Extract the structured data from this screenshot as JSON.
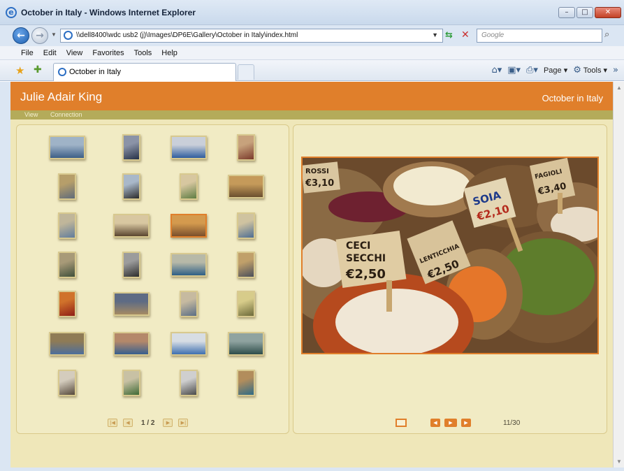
{
  "window": {
    "title": "October in Italy - Windows Internet Explorer"
  },
  "address_bar": {
    "url": "\\\\dell8400\\wdc usb2 (j)\\Images\\DP6E\\Gallery\\October in Italy\\index.html",
    "search_placeholder": "Google"
  },
  "menu": [
    "File",
    "Edit",
    "View",
    "Favorites",
    "Tools",
    "Help"
  ],
  "tab": {
    "label": "October in Italy"
  },
  "command_bar": {
    "page_label": "Page",
    "tools_label": "Tools"
  },
  "site": {
    "author": "Julie Adair King",
    "gallery_title": "October in Italy",
    "nav": [
      "View",
      "Connection"
    ]
  },
  "thumbnails": {
    "page_indicator": "1 / 2",
    "selected_index": 10,
    "items": [
      {
        "name": "harbor boats",
        "colors": [
          "#3d5f87",
          "#9fb3c7"
        ]
      },
      {
        "name": "cathedral night",
        "colors": [
          "#253147",
          "#8b93a7"
        ]
      },
      {
        "name": "statues skyline",
        "colors": [
          "#2f5d9e",
          "#c9cfd9"
        ]
      },
      {
        "name": "flag doorway",
        "colors": [
          "#7b3a2b",
          "#c7a27c"
        ]
      },
      {
        "name": "bridge river",
        "colors": [
          "#5f6b7a",
          "#b69e6a"
        ]
      },
      {
        "name": "tower silhouette",
        "colors": [
          "#2a2a2a",
          "#a9b8c9"
        ]
      },
      {
        "name": "garden villa",
        "colors": [
          "#5f7d43",
          "#d7c7a0"
        ]
      },
      {
        "name": "castle bridge",
        "colors": [
          "#6b4f2f",
          "#c59a5a"
        ]
      },
      {
        "name": "statue fountain",
        "colors": [
          "#617c9c",
          "#c0b69a"
        ]
      },
      {
        "name": "colonnade",
        "colors": [
          "#5a4530",
          "#d8c7a1"
        ]
      },
      {
        "name": "market spices",
        "colors": [
          "#7a4f2c",
          "#d49a4e"
        ]
      },
      {
        "name": "ruins",
        "colors": [
          "#4d6d93",
          "#cfc3a0"
        ]
      },
      {
        "name": "street archway",
        "colors": [
          "#3f4f3a",
          "#a89a78"
        ]
      },
      {
        "name": "carved statue",
        "colors": [
          "#2c2c2c",
          "#9c9c9c"
        ]
      },
      {
        "name": "marina",
        "colors": [
          "#2e5f86",
          "#b7b9a8"
        ]
      },
      {
        "name": "bronze statue",
        "colors": [
          "#4a4f5a",
          "#c0a06a"
        ]
      },
      {
        "name": "chili peppers",
        "colors": [
          "#8f1e16",
          "#d0722b"
        ]
      },
      {
        "name": "pasta display",
        "colors": [
          "#a58a63",
          "#5e6b84"
        ]
      },
      {
        "name": "church facade",
        "colors": [
          "#5b6e85",
          "#c6baa0"
        ]
      },
      {
        "name": "old map",
        "colors": [
          "#6d6a3a",
          "#d7cc8a"
        ]
      },
      {
        "name": "amphitheater ruins",
        "colors": [
          "#4c6e9c",
          "#8f7b56"
        ]
      },
      {
        "name": "coastal town",
        "colors": [
          "#375f8e",
          "#b4886a"
        ]
      },
      {
        "name": "hillside village",
        "colors": [
          "#3e6fb0",
          "#d7dde4"
        ]
      },
      {
        "name": "sea rocks",
        "colors": [
          "#2e4d4a",
          "#8fa3a0"
        ]
      },
      {
        "name": "marble statue",
        "colors": [
          "#55483a",
          "#d4ccbd"
        ]
      },
      {
        "name": "garden path",
        "colors": [
          "#3f6a35",
          "#c8c1a4"
        ]
      },
      {
        "name": "ornate building",
        "colors": [
          "#4a4a4a",
          "#cfcfcf"
        ]
      },
      {
        "name": "coastline cliff",
        "colors": [
          "#2f6b86",
          "#b28d5c"
        ]
      }
    ]
  },
  "viewer": {
    "counter": "11/30",
    "photo_signs": [
      "ROSSI €3,10",
      "CECI SECCHI € 2,50 KG",
      "LENTICCHIA DECORTICATA € 2,50",
      "SOIA € 2,10",
      "FAGIOLI € 3,40"
    ]
  },
  "colors": {
    "header": "#e07f2b",
    "subnav": "#b4ab5a",
    "page_bg": "#efe7b9",
    "panel_bg": "#f1ebc4"
  }
}
